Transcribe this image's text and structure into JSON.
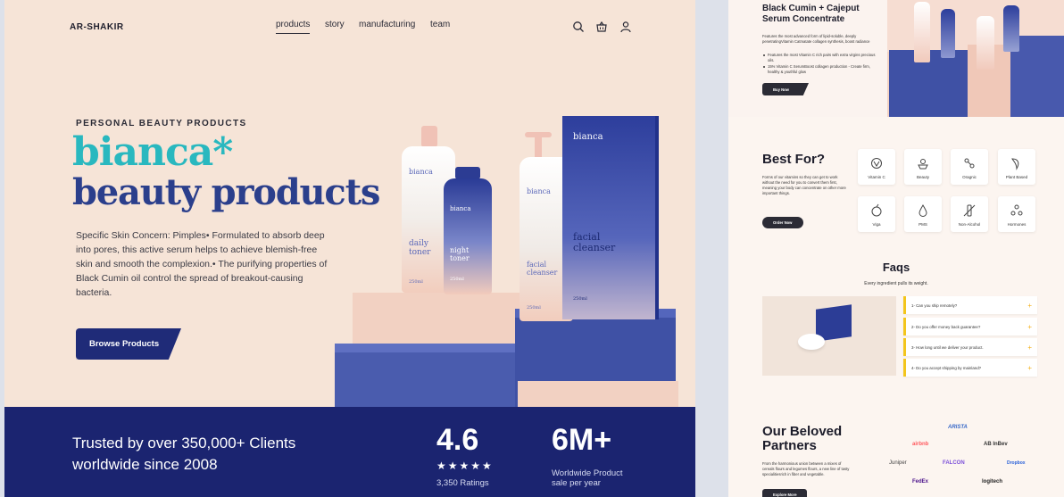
{
  "left": {
    "brand": "AR-SHAKIR",
    "nav": [
      "products",
      "story",
      "manufacturing",
      "team"
    ],
    "eyebrow": "PERSONAL BEAUTY PRODUCTS",
    "headline_1": "bianca*",
    "headline_2": "beauty products",
    "description": "Specific Skin Concern: Pimples• Formulated to absorb deep into pores, this active serum helps to achieve blemish-free skin and smooth the complexion.• The purifying properties of Black Cumin oil control the spread of breakout-causing bacteria.",
    "cta": "Browse Products",
    "products": {
      "brand": "bianca",
      "toner1": "daily toner",
      "toner2": "night toner",
      "cleanser": "facial cleanser",
      "box": "facial cleanser",
      "box_brand": "bianca",
      "vol_a": "250ml",
      "vol_b": "250ml",
      "vol_c": "250ml",
      "vol_d": "250ml"
    },
    "trust": "Trusted by over 350,000+ Clients worldwide since 2008",
    "rating_value": "4.6",
    "rating_stars": "★★★★★",
    "rating_label": "3,350 Ratings",
    "sales_value": "6M+",
    "sales_label_1": "Worldwide Product",
    "sales_label_2": "sale per year",
    "colors": {
      "accent_teal": "#29b8bf",
      "navy": "#1b2470",
      "peach": "#f6e4d7"
    }
  },
  "right": {
    "product_title_1": "Black Cumin + Cajeput",
    "product_title_2": "Serum Concentrate",
    "product_desc": "Features the most advanced form of lipid-soluble, deeply penetratingVitamin Catmatate collagen synthesis, boost radiance",
    "bullet_1": "Features the most Vitamin C rich pairs with extra virgins precious oils.",
    "bullet_2": "15% Vitamin C SerumBoost collagen production - Create firm, healthy & youthful glow",
    "buy": "Buy Now",
    "bestfor_title": "Best For?",
    "bestfor_desc": "Forms of our vitamins so they can get to work without the need for you to convert them first, meaning your body can concentrate on other more important things.",
    "order": "Order Now",
    "tiles": [
      "Vitamin C",
      "Beauty",
      "Oragnic",
      "Plant Based",
      "Viga",
      "PMS",
      "Non-Alcohol",
      "Hormones"
    ],
    "faqs_title": "Faqs",
    "faqs_sub": "Every ingredient pulls its weight.",
    "faqs": [
      "1- Can you ship remotely?",
      "2- Do you offer money back guarantee?",
      "3- How long until we deliver your product.",
      "4- Do you accept shipping by mainland?"
    ],
    "partners_title_1": "Our Beloved",
    "partners_title_2": "Partners",
    "partners_desc": "From the harmonious union between a mixes of cereals flours and legumes flours, a new line of tasty specialitiesrich in fiber and vegetable.",
    "partners_btn": "Explore More",
    "partners": [
      "ARISTA",
      "airbnb",
      "AB InBev",
      "Juniper",
      "FALCON",
      "Dropbox",
      "FedEx",
      "logitech"
    ]
  }
}
